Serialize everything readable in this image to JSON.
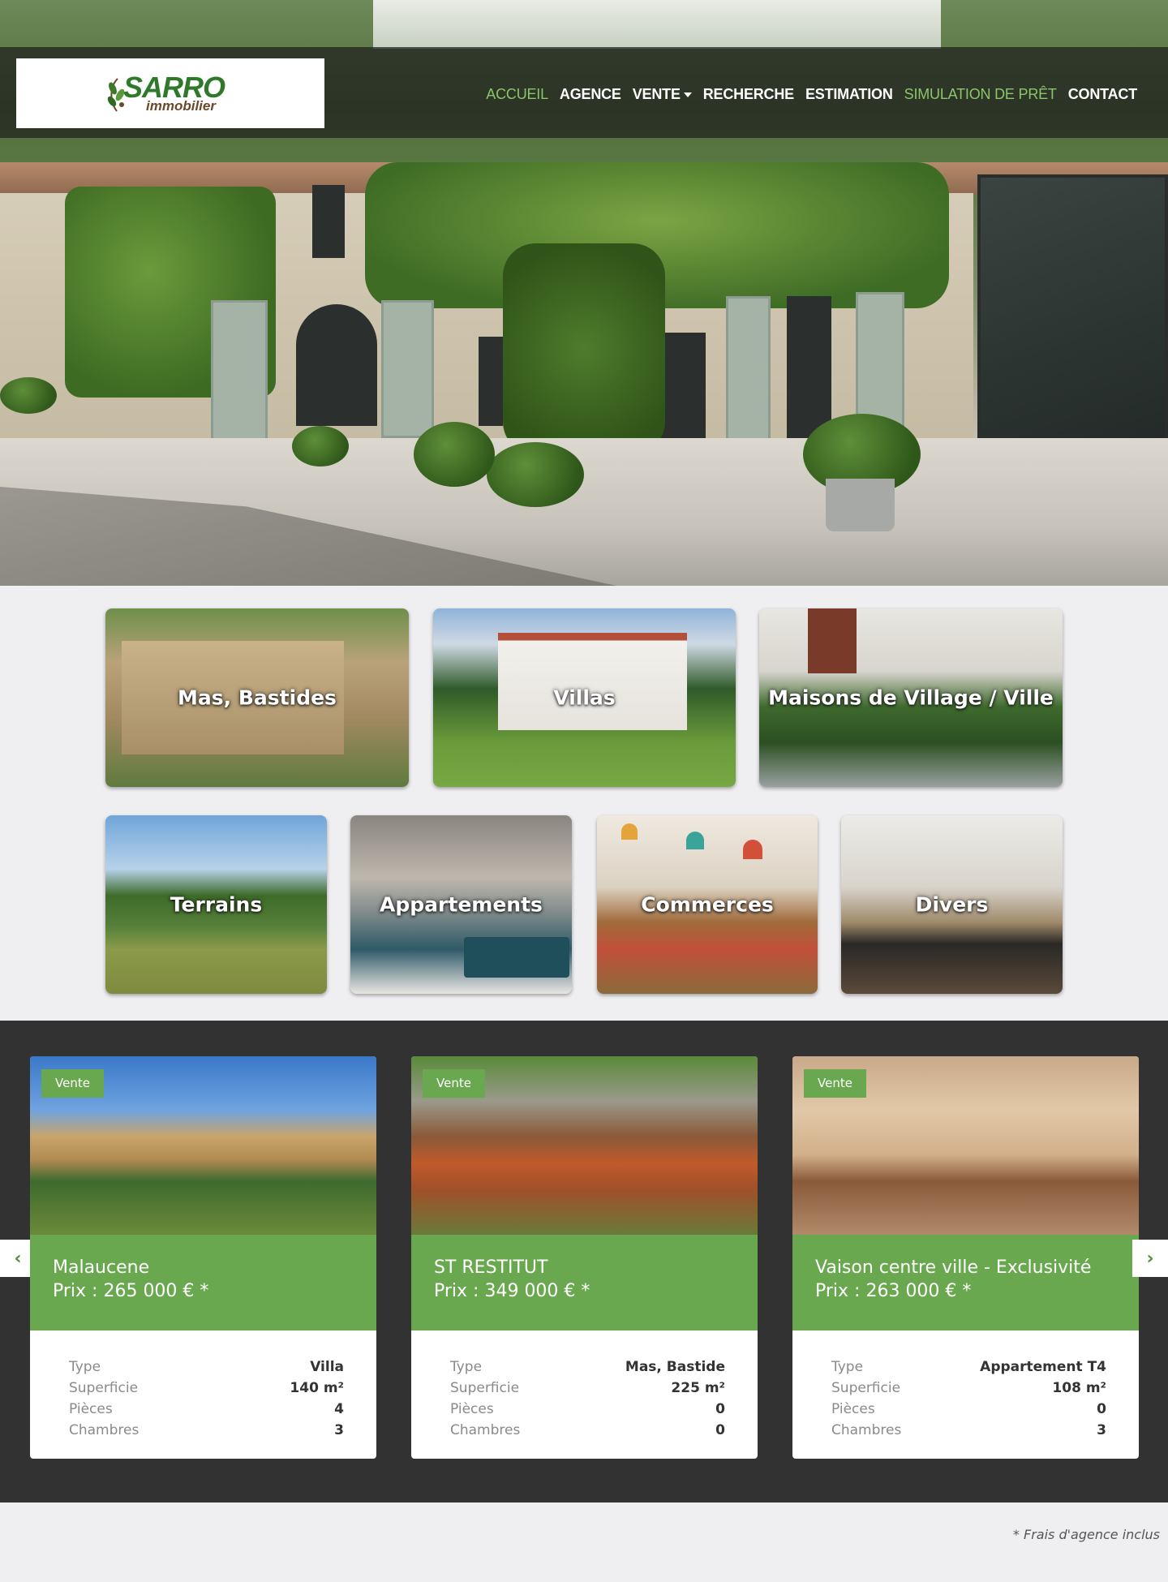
{
  "brand": {
    "name": "SARRO",
    "sub": "immobilier",
    "color": "#2f7a2a"
  },
  "nav": {
    "items": [
      {
        "label": "ACCUEIL",
        "active": true
      },
      {
        "label": "AGENCE"
      },
      {
        "label": "VENTE",
        "dropdown": true
      },
      {
        "label": "RECHERCHE"
      },
      {
        "label": "ESTIMATION"
      },
      {
        "label": "SIMULATION DE PRÊT",
        "highlight": true
      },
      {
        "label": "CONTACT"
      }
    ]
  },
  "categories": [
    "Mas, Bastides",
    "Villas",
    "Maisons de Village / Ville",
    "Terrains",
    "Appartements",
    "Commerces",
    "Divers"
  ],
  "listings": [
    {
      "badge": "Vente",
      "title": "Malaucene",
      "price": "Prix : 265 000 € *",
      "specs": [
        {
          "k": "Type",
          "v": "Villa"
        },
        {
          "k": "Superficie",
          "v": "140 m²"
        },
        {
          "k": "Pièces",
          "v": "4"
        },
        {
          "k": "Chambres",
          "v": "3"
        }
      ]
    },
    {
      "badge": "Vente",
      "title": "ST RESTITUT",
      "price": "Prix : 349 000 € *",
      "specs": [
        {
          "k": "Type",
          "v": "Mas, Bastide"
        },
        {
          "k": "Superficie",
          "v": "225 m²"
        },
        {
          "k": "Pièces",
          "v": "0"
        },
        {
          "k": "Chambres",
          "v": "0"
        }
      ]
    },
    {
      "badge": "Vente",
      "title": "Vaison centre ville - Exclusivité",
      "price": "Prix : 263 000 € *",
      "specs": [
        {
          "k": "Type",
          "v": "Appartement T4"
        },
        {
          "k": "Superficie",
          "v": "108 m²"
        },
        {
          "k": "Pièces",
          "v": "0"
        },
        {
          "k": "Chambres",
          "v": "3"
        }
      ]
    }
  ],
  "carousel": {
    "prev_icon": "chevron-left-icon",
    "next_icon": "chevron-right-icon"
  },
  "footnote": "* Frais d'agence inclus",
  "colors": {
    "accent": "#6aa84f",
    "dark": "#323232",
    "nav_active": "#8cc46b"
  }
}
